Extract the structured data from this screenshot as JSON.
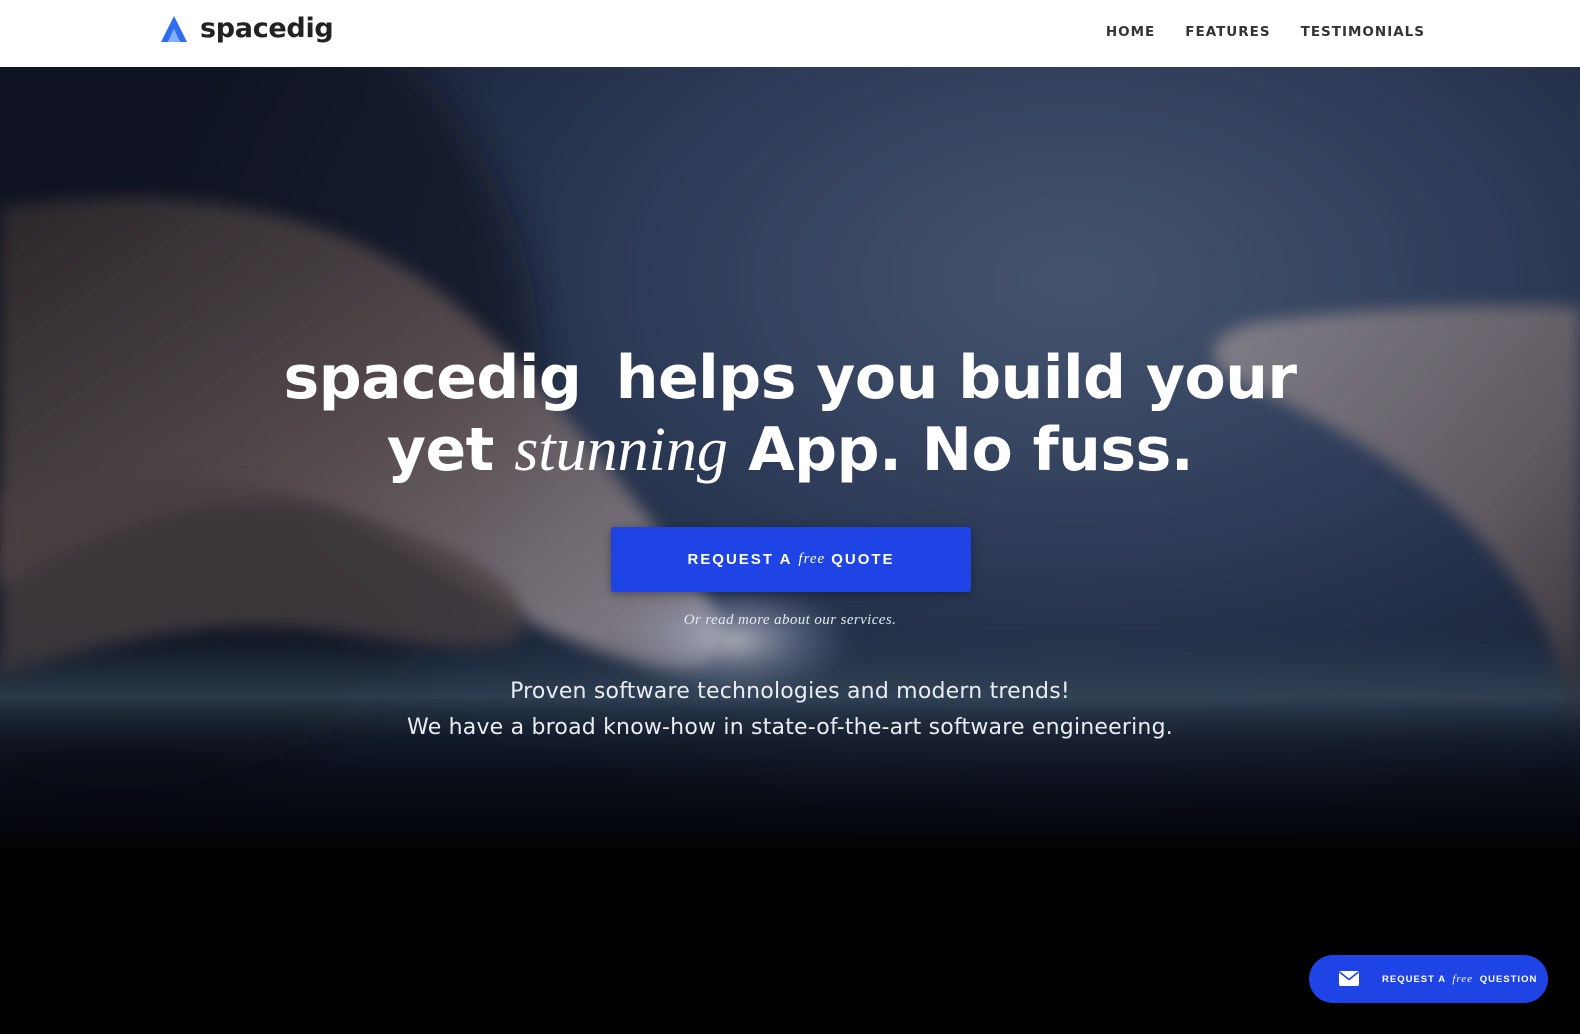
{
  "header": {
    "logo_text": "spacedig",
    "nav": [
      {
        "label": "HOME"
      },
      {
        "label": "FEATURES"
      },
      {
        "label": "TESTIMONIALS"
      }
    ]
  },
  "hero": {
    "title_line1_brand": "spacedig",
    "title_line1_rest": "helps you build your",
    "title_line2_start": "yet",
    "title_line2_italic": "stunning",
    "title_line2_end": "App. No fuss.",
    "cta_prefix": "REQUEST A",
    "cta_italic": "free",
    "cta_suffix": "QUOTE",
    "read_more": "Or read more about our services.",
    "tagline_line1": "Proven software technologies and modern trends!",
    "tagline_line2": "We have a broad know-how in state-of-the-art software engineering."
  },
  "fab": {
    "prefix": "REQUEST A",
    "italic": "free",
    "suffix": "QUESTION",
    "icon": "envelope-icon"
  },
  "colors": {
    "accent": "#1f44e6",
    "logo_blue": "#2f6cf0",
    "nav_text": "#333333",
    "header_bg": "#ffffff"
  }
}
